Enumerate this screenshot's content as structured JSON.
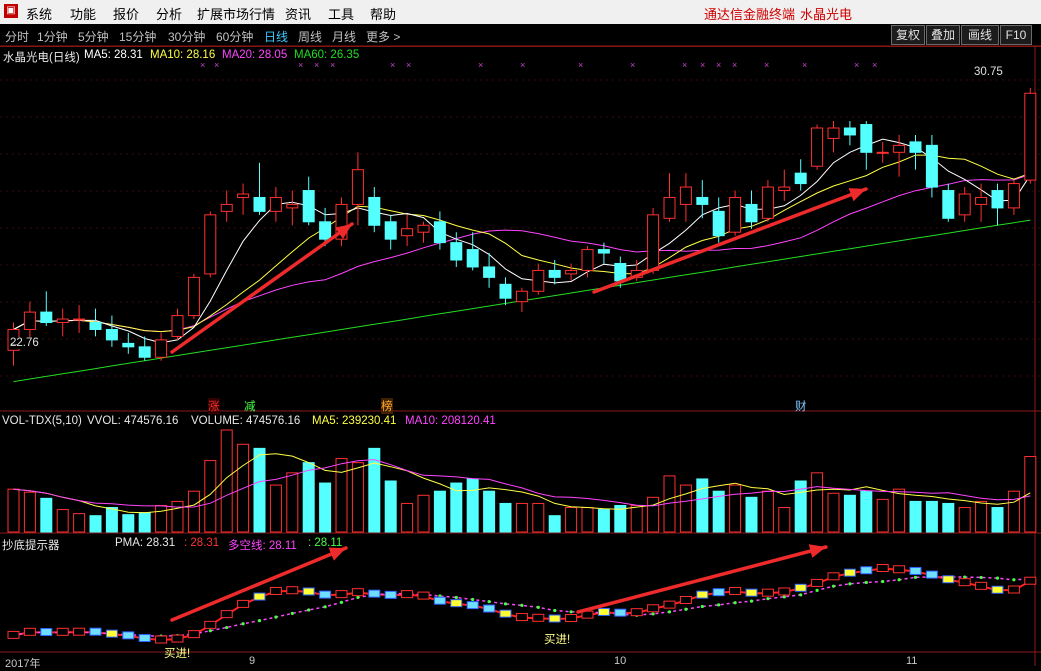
{
  "menu": {
    "items": [
      "系统",
      "功能",
      "报价",
      "分析",
      "扩展市场行情",
      "资讯",
      "工具",
      "帮助"
    ],
    "terminal_name": "通达信金融终端",
    "stock_title": "水晶光电"
  },
  "timeframes": {
    "items": [
      "分时",
      "1分钟",
      "5分钟",
      "15分钟",
      "30分钟",
      "60分钟",
      "日线",
      "周线",
      "月线",
      "更多 >"
    ],
    "active": "日线"
  },
  "toolbar": {
    "buttons": [
      "复权",
      "叠加",
      "画线",
      "F10"
    ]
  },
  "main_chart": {
    "stock_label": "水晶光电(日线)",
    "ma5": "MA5: 28.31",
    "ma10": "MA10: 28.16",
    "ma20": "MA20: 28.05",
    "ma60": "MA60: 26.35",
    "high_label": "30.75",
    "low_label": "22.76",
    "event_markers": [
      "涨",
      "减",
      "榜",
      "财"
    ],
    "colors": {
      "up": "#ff3030",
      "down": "#54ffff",
      "ma5": "#ffffff",
      "ma10": "#ffff44",
      "ma20": "#ff44ff",
      "ma60": "#22dd22"
    }
  },
  "volume_panel": {
    "indicator": "VOL-TDX(5,10)",
    "vvol": "VVOL: 474576.16",
    "volume": "VOLUME: 474576.16",
    "ma5": "MA5: 239230.41",
    "ma10": "MA10: 208120.41"
  },
  "bottom_panel": {
    "indicator": "抄底提示器",
    "pma_label": "PMA: 28.31",
    "pma_value": ": 28.31",
    "dkx_label": "多空线: 28.11",
    "dkx_value": ": 28.11",
    "buy_signal_1": "买进!",
    "buy_signal_2": "买进!"
  },
  "date_axis": [
    "2017年",
    "9",
    "10",
    "11"
  ],
  "chart_data": {
    "type": "candlestick",
    "y_range": [
      22.0,
      31.5
    ],
    "candles": [
      {
        "o": 23.2,
        "h": 24.0,
        "l": 22.76,
        "c": 23.8
      },
      {
        "o": 23.8,
        "h": 24.6,
        "l": 23.5,
        "c": 24.3
      },
      {
        "o": 24.3,
        "h": 24.9,
        "l": 23.9,
        "c": 24.0
      },
      {
        "o": 24.0,
        "h": 24.4,
        "l": 23.6,
        "c": 24.1
      },
      {
        "o": 24.1,
        "h": 24.5,
        "l": 23.7,
        "c": 24.1
      },
      {
        "o": 24.0,
        "h": 24.4,
        "l": 23.6,
        "c": 23.8
      },
      {
        "o": 23.8,
        "h": 24.2,
        "l": 23.3,
        "c": 23.5
      },
      {
        "o": 23.4,
        "h": 23.7,
        "l": 23.1,
        "c": 23.3
      },
      {
        "o": 23.3,
        "h": 23.6,
        "l": 22.9,
        "c": 23.0
      },
      {
        "o": 23.0,
        "h": 23.7,
        "l": 22.9,
        "c": 23.5
      },
      {
        "o": 23.6,
        "h": 24.4,
        "l": 23.5,
        "c": 24.2
      },
      {
        "o": 24.2,
        "h": 25.4,
        "l": 24.1,
        "c": 25.3
      },
      {
        "o": 25.4,
        "h": 27.2,
        "l": 25.3,
        "c": 27.1
      },
      {
        "o": 27.2,
        "h": 27.8,
        "l": 26.9,
        "c": 27.4
      },
      {
        "o": 27.6,
        "h": 28.0,
        "l": 27.1,
        "c": 27.7
      },
      {
        "o": 27.6,
        "h": 28.6,
        "l": 27.1,
        "c": 27.2
      },
      {
        "o": 27.2,
        "h": 27.9,
        "l": 26.9,
        "c": 27.6
      },
      {
        "o": 27.3,
        "h": 27.8,
        "l": 26.8,
        "c": 27.4
      },
      {
        "o": 27.8,
        "h": 28.2,
        "l": 26.8,
        "c": 26.9
      },
      {
        "o": 26.9,
        "h": 27.3,
        "l": 26.2,
        "c": 26.4
      },
      {
        "o": 26.4,
        "h": 27.6,
        "l": 26.2,
        "c": 27.4
      },
      {
        "o": 27.4,
        "h": 28.9,
        "l": 26.8,
        "c": 28.4
      },
      {
        "o": 27.6,
        "h": 27.9,
        "l": 26.6,
        "c": 26.8
      },
      {
        "o": 26.9,
        "h": 27.1,
        "l": 26.1,
        "c": 26.4
      },
      {
        "o": 26.5,
        "h": 27.1,
        "l": 26.2,
        "c": 26.7
      },
      {
        "o": 26.6,
        "h": 26.9,
        "l": 26.3,
        "c": 26.8
      },
      {
        "o": 26.9,
        "h": 27.2,
        "l": 26.1,
        "c": 26.3
      },
      {
        "o": 26.3,
        "h": 26.6,
        "l": 25.6,
        "c": 25.8
      },
      {
        "o": 26.1,
        "h": 26.6,
        "l": 25.5,
        "c": 25.6
      },
      {
        "o": 25.6,
        "h": 26.0,
        "l": 25.0,
        "c": 25.3
      },
      {
        "o": 25.1,
        "h": 25.3,
        "l": 24.5,
        "c": 24.7
      },
      {
        "o": 24.6,
        "h": 25.0,
        "l": 24.3,
        "c": 24.9
      },
      {
        "o": 24.9,
        "h": 25.7,
        "l": 24.8,
        "c": 25.5
      },
      {
        "o": 25.5,
        "h": 25.8,
        "l": 25.1,
        "c": 25.3
      },
      {
        "o": 25.4,
        "h": 25.7,
        "l": 25.2,
        "c": 25.5
      },
      {
        "o": 25.5,
        "h": 26.2,
        "l": 25.3,
        "c": 26.1
      },
      {
        "o": 26.1,
        "h": 26.3,
        "l": 25.7,
        "c": 26.0
      },
      {
        "o": 25.7,
        "h": 25.9,
        "l": 25.0,
        "c": 25.2
      },
      {
        "o": 25.3,
        "h": 25.8,
        "l": 25.2,
        "c": 25.5
      },
      {
        "o": 25.5,
        "h": 27.3,
        "l": 25.4,
        "c": 27.1
      },
      {
        "o": 27.0,
        "h": 28.3,
        "l": 26.9,
        "c": 27.6
      },
      {
        "o": 27.4,
        "h": 28.3,
        "l": 26.9,
        "c": 27.9
      },
      {
        "o": 27.6,
        "h": 28.1,
        "l": 27.0,
        "c": 27.4
      },
      {
        "o": 27.2,
        "h": 27.6,
        "l": 26.3,
        "c": 26.5
      },
      {
        "o": 26.6,
        "h": 27.8,
        "l": 26.5,
        "c": 27.6
      },
      {
        "o": 27.4,
        "h": 27.8,
        "l": 26.7,
        "c": 26.9
      },
      {
        "o": 27.0,
        "h": 28.1,
        "l": 26.9,
        "c": 27.9
      },
      {
        "o": 27.8,
        "h": 28.4,
        "l": 27.5,
        "c": 27.9
      },
      {
        "o": 28.3,
        "h": 28.7,
        "l": 27.8,
        "c": 28.0
      },
      {
        "o": 28.5,
        "h": 29.7,
        "l": 28.4,
        "c": 29.6
      },
      {
        "o": 29.3,
        "h": 29.8,
        "l": 28.9,
        "c": 29.6
      },
      {
        "o": 29.6,
        "h": 29.8,
        "l": 29.1,
        "c": 29.4
      },
      {
        "o": 29.7,
        "h": 29.8,
        "l": 28.4,
        "c": 28.9
      },
      {
        "o": 28.9,
        "h": 29.2,
        "l": 28.6,
        "c": 28.9
      },
      {
        "o": 28.9,
        "h": 29.4,
        "l": 28.2,
        "c": 29.1
      },
      {
        "o": 29.2,
        "h": 29.4,
        "l": 28.4,
        "c": 28.9
      },
      {
        "o": 29.1,
        "h": 29.4,
        "l": 27.6,
        "c": 27.9
      },
      {
        "o": 27.8,
        "h": 28.0,
        "l": 26.9,
        "c": 27.0
      },
      {
        "o": 27.1,
        "h": 27.9,
        "l": 26.9,
        "c": 27.7
      },
      {
        "o": 27.4,
        "h": 28.0,
        "l": 26.9,
        "c": 27.6
      },
      {
        "o": 27.8,
        "h": 28.0,
        "l": 26.8,
        "c": 27.3
      },
      {
        "o": 27.3,
        "h": 28.1,
        "l": 27.1,
        "c": 28.0
      },
      {
        "o": 28.1,
        "h": 30.75,
        "l": 28.0,
        "c": 30.6
      }
    ],
    "volume": [
      0.42,
      0.39,
      0.33,
      0.22,
      0.18,
      0.16,
      0.24,
      0.17,
      0.19,
      0.26,
      0.3,
      0.4,
      0.7,
      1.0,
      0.86,
      0.82,
      0.46,
      0.58,
      0.68,
      0.48,
      0.72,
      0.68,
      0.82,
      0.5,
      0.28,
      0.36,
      0.4,
      0.48,
      0.52,
      0.4,
      0.28,
      0.28,
      0.28,
      0.16,
      0.24,
      0.24,
      0.22,
      0.26,
      0.26,
      0.34,
      0.55,
      0.46,
      0.52,
      0.4,
      0.46,
      0.34,
      0.4,
      0.24,
      0.5,
      0.58,
      0.38,
      0.36,
      0.4,
      0.32,
      0.42,
      0.3,
      0.3,
      0.28,
      0.24,
      0.3,
      0.24,
      0.4,
      0.74
    ]
  }
}
